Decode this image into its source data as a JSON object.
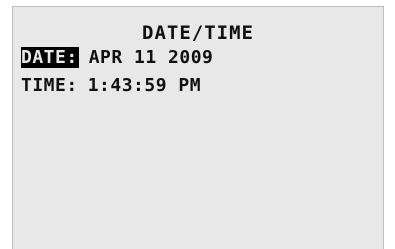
{
  "screen": {
    "title": "DATE/TIME",
    "date_row": {
      "label": "DATE:",
      "value": "APR 11 2009",
      "selected": true
    },
    "time_row": {
      "label": "TIME:",
      "value": "1:43:59 PM"
    }
  },
  "colors": {
    "screen_background": "#e8e8e8",
    "text": "#111111",
    "highlight_background": "#000000"
  }
}
